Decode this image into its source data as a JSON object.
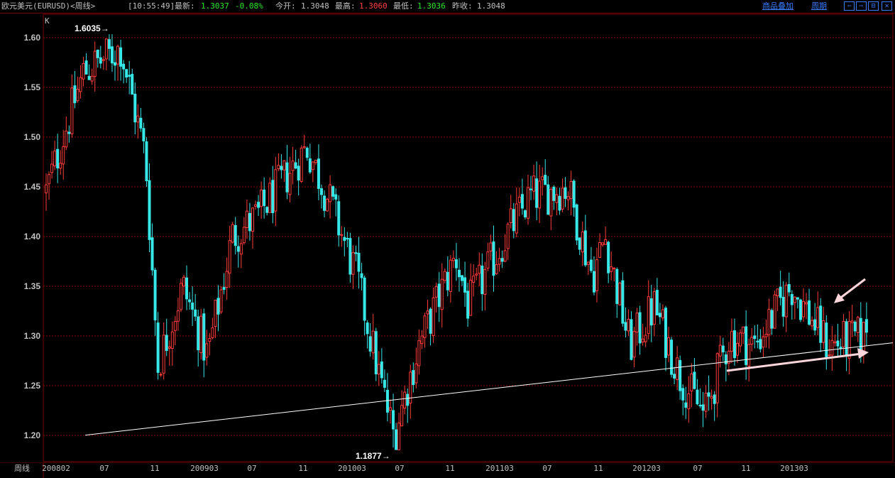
{
  "header": {
    "symbol": "欧元美元(EURUSD)<周线>",
    "time": "[10:55:49]",
    "latest_label": "最新:",
    "latest_value": "1.3037",
    "change": "-0.08%",
    "open_label": "今开:",
    "open_value": "1.3048",
    "high_label": "最高:",
    "high_value": "1.3060",
    "low_label": "最低:",
    "low_value": "1.3036",
    "prev_close_label": "昨收:",
    "prev_close_value": "1.3048",
    "overlay_link": "商品叠加",
    "period_link": "周期",
    "buttons": [
      "⇦",
      "⇨",
      "⊟",
      "✕"
    ]
  },
  "bottom": {
    "period_label": "周线"
  },
  "colors": {
    "up": "#ff3b3b",
    "down": "#36e8e8",
    "grid": "#8b0000",
    "axis_text": "#c0c0c0",
    "trend_line": "#ffffff",
    "arrow": "#ffd6dc",
    "link": "#3a7bff"
  },
  "chart_data": {
    "type": "candlestick",
    "indicator_label": "K",
    "ylim": [
      1.18,
      1.625
    ],
    "yticks": [
      1.2,
      1.25,
      1.3,
      1.35,
      1.4,
      1.45,
      1.5,
      1.55,
      1.6
    ],
    "x_tick_labels": [
      "200802",
      "07",
      "11",
      "200903",
      "07",
      "11",
      "201003",
      "07",
      "11",
      "201103",
      "07",
      "11",
      "201203",
      "07",
      "11",
      "201303"
    ],
    "max_annotation": {
      "label": "1.6035",
      "value": 1.6035
    },
    "min_annotation": {
      "label": "1.1877",
      "value": 1.1877
    },
    "trend_line": {
      "start": [
        "200805",
        1.2
      ],
      "end": [
        "201308",
        1.29
      ]
    },
    "anchors": [
      [
        "200802",
        1.445
      ],
      [
        "200805",
        1.565
      ],
      [
        "200808",
        1.59
      ],
      [
        "200810",
        1.48
      ],
      [
        "200811",
        1.27
      ],
      [
        "200901",
        1.35
      ],
      [
        "200903",
        1.28
      ],
      [
        "200905",
        1.4
      ],
      [
        "200907",
        1.42
      ],
      [
        "200911",
        1.49
      ],
      [
        "201001",
        1.43
      ],
      [
        "201003",
        1.36
      ],
      [
        "201005",
        1.25
      ],
      [
        "201006",
        1.2
      ],
      [
        "201008",
        1.29
      ],
      [
        "201011",
        1.38
      ],
      [
        "201012",
        1.33
      ],
      [
        "201103",
        1.4
      ],
      [
        "201105",
        1.44
      ],
      [
        "201108",
        1.45
      ],
      [
        "201110",
        1.36
      ],
      [
        "201111",
        1.4
      ],
      [
        "201201",
        1.29
      ],
      [
        "201203",
        1.33
      ],
      [
        "201205",
        1.26
      ],
      [
        "201207",
        1.22
      ],
      [
        "201209",
        1.3
      ],
      [
        "201211",
        1.29
      ],
      [
        "201302",
        1.35
      ],
      [
        "201305",
        1.29
      ],
      [
        "201308",
        1.3
      ]
    ],
    "current_value": 1.3037
  }
}
